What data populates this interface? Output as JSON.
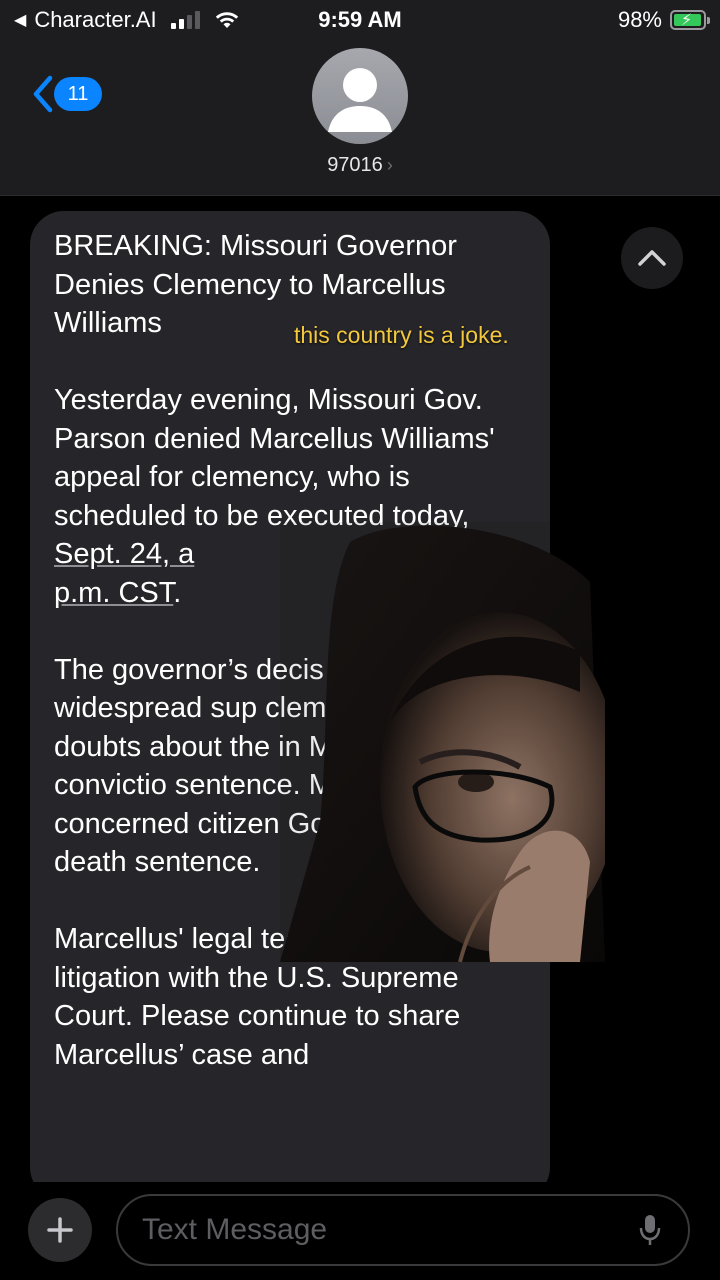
{
  "status_bar": {
    "back_app": "Character.AI",
    "time": "9:59 AM",
    "battery_percent": "98%",
    "battery_level": 0.98,
    "signal_bars": 2
  },
  "header": {
    "back_count": "11",
    "contact": "97016"
  },
  "message": {
    "title": "BREAKING: Missouri Governor Denies Clemency to Marcellus Williams",
    "para1_before_link": "Yesterday evening, Missouri Gov. Parson denied Marcellus Williams' appeal for clemency, who is scheduled to be executed today, ",
    "para1_link1": "Sept. 24, a",
    "para1_between": "",
    "para1_link2": "p.m. CST",
    "para1_end": ".",
    "para2": "The governor’s decis the widespread sup clemency based on doubts about the in Marcellus’ convictio sentence. More than concerned citizen Gov. Parson to death sentence.",
    "para3": "Marcellus' legal team is still in active litigation with the U.S. Supreme Court. Please continue to share Marcellus’ case and"
  },
  "overlay_caption": "this country is a joke.",
  "input": {
    "placeholder": "Text Message"
  },
  "icons": {
    "back": "chevron-left-icon",
    "scroll": "chevron-up-icon",
    "plus": "plus-icon",
    "mic": "microphone-icon"
  },
  "colors": {
    "accent": "#0a84ff",
    "caption": "#f3c83c",
    "battery": "#34c759",
    "bubble": "#26262a"
  }
}
